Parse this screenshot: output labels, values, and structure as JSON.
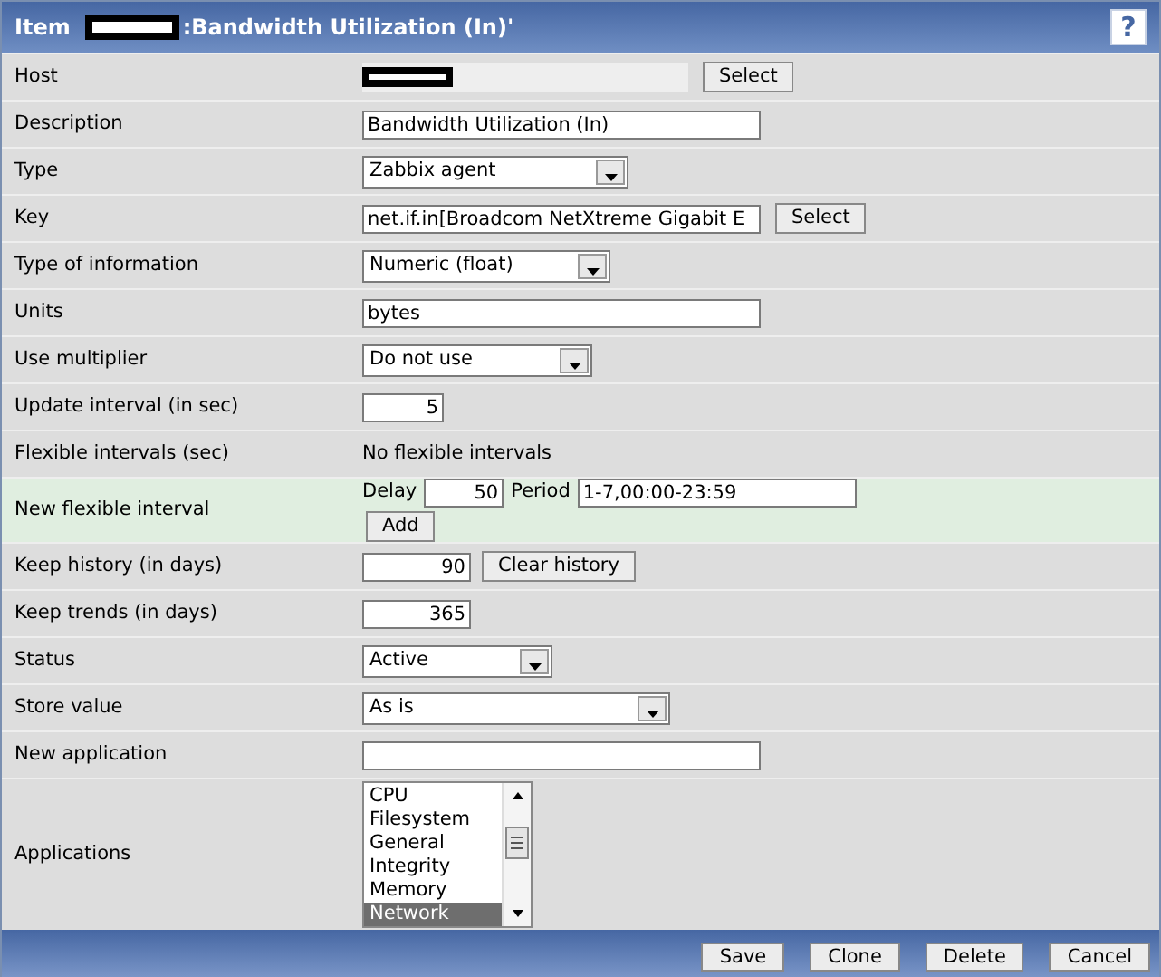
{
  "header": {
    "title_prefix": "Item",
    "title_redacted": true,
    "title_suffix": ":Bandwidth Utilization (In)'",
    "help": "?"
  },
  "fields": [
    {
      "label": "Host",
      "kind": "readonly",
      "redacted": true,
      "button": "Select"
    },
    {
      "label": "Description",
      "kind": "text",
      "value": "Bandwidth Utilization (In)"
    },
    {
      "label": "Type",
      "kind": "select",
      "value": "Zabbix agent"
    },
    {
      "label": "Key",
      "kind": "text",
      "value": "net.if.in[Broadcom NetXtreme Gigabit E",
      "button": "Select"
    },
    {
      "label": "Type of information",
      "kind": "select",
      "value": "Numeric (float)"
    },
    {
      "label": "Units",
      "kind": "text",
      "value": "bytes"
    },
    {
      "label": "Use multiplier",
      "kind": "select",
      "value": "Do not use"
    },
    {
      "label": "Update interval (in sec)",
      "kind": "number",
      "value": "5"
    },
    {
      "label": "Flexible intervals (sec)",
      "kind": "static",
      "value": "No flexible intervals"
    },
    {
      "label": "New flexible interval",
      "kind": "flex",
      "highlighted": true,
      "delay_label": "Delay",
      "delay": "50",
      "period_label": "Period",
      "period": "1-7,00:00-23:59",
      "button": "Add"
    },
    {
      "label": "Keep history (in days)",
      "kind": "number",
      "value": "90",
      "button": "Clear history"
    },
    {
      "label": "Keep trends (in days)",
      "kind": "number",
      "value": "365"
    },
    {
      "label": "Status",
      "kind": "select",
      "value": "Active"
    },
    {
      "label": "Store value",
      "kind": "select",
      "value": "As is"
    },
    {
      "label": "New application",
      "kind": "text"
    },
    {
      "label": "Applications",
      "kind": "listbox",
      "options": [
        {
          "text": "CPU",
          "selected": false
        },
        {
          "text": "Filesystem",
          "selected": false
        },
        {
          "text": "General",
          "selected": false
        },
        {
          "text": "Integrity",
          "selected": false
        },
        {
          "text": "Memory",
          "selected": false
        },
        {
          "text": "Network",
          "selected": true
        }
      ]
    }
  ],
  "footer_buttons": [
    "Save",
    "Clone",
    "Delete",
    "Cancel"
  ]
}
